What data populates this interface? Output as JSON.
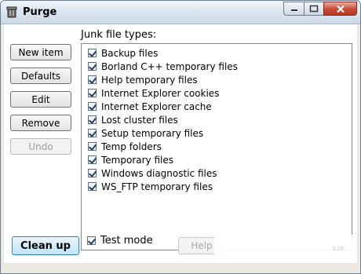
{
  "window": {
    "title": "Purge"
  },
  "sidebar": {
    "new_item": "New item",
    "defaults": "Defaults",
    "edit": "Edit",
    "remove": "Remove",
    "undo": "Undo"
  },
  "junk": {
    "label": "Junk file types:",
    "items": [
      {
        "label": "Backup files",
        "checked": true
      },
      {
        "label": "Borland C++ temporary files",
        "checked": true
      },
      {
        "label": "Help temporary files",
        "checked": true
      },
      {
        "label": "Internet Explorer cookies",
        "checked": true
      },
      {
        "label": "Internet Explorer cache",
        "checked": true
      },
      {
        "label": "Lost cluster files",
        "checked": true
      },
      {
        "label": "Setup temporary files",
        "checked": true
      },
      {
        "label": "Temp folders",
        "checked": true
      },
      {
        "label": "Temporary files",
        "checked": true
      },
      {
        "label": "Windows diagnostic files",
        "checked": true
      },
      {
        "label": "WS_FTP temporary files",
        "checked": true
      }
    ]
  },
  "footer": {
    "cleanup": "Clean up",
    "test_mode": "Test mode",
    "test_mode_checked": true,
    "help": "Help",
    "watermark": "3.26"
  },
  "colors": {
    "titlebar": "#d9e4f0",
    "close": "#c94a35",
    "cleanup_border": "#3c7fb1"
  }
}
